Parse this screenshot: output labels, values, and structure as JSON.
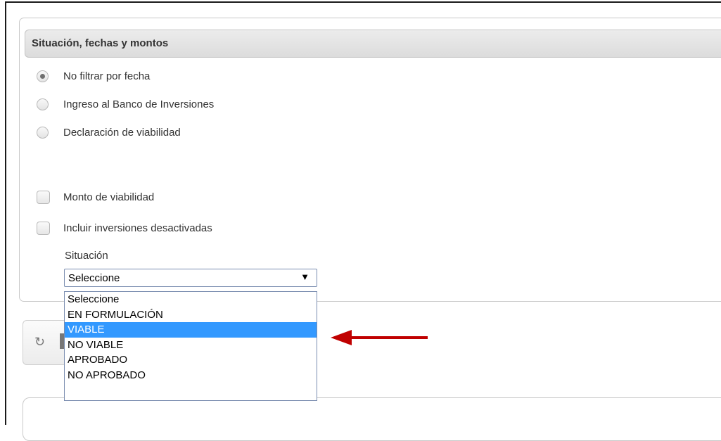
{
  "panel": {
    "title": "Situación, fechas y montos"
  },
  "date_filters": [
    {
      "label": "No filtrar por fecha",
      "checked": true
    },
    {
      "label": "Ingreso al Banco de Inversiones",
      "checked": false
    },
    {
      "label": "Declaración de viabilidad",
      "checked": false
    }
  ],
  "checkboxes": [
    {
      "label": "Monto de viabilidad",
      "checked": false
    },
    {
      "label": "Incluir inversiones desactivadas",
      "checked": false
    }
  ],
  "situacion": {
    "label": "Situación",
    "selected_value": "Seleccione",
    "options": [
      "Seleccione",
      "EN FORMULACIÓN",
      "VIABLE",
      "NO VIABLE",
      "APROBADO",
      "NO APROBADO"
    ],
    "highlighted_option": "VIABLE"
  },
  "colors": {
    "highlight": "#3399ff",
    "annotation_arrow": "#c00000"
  },
  "icons": {
    "refresh_button_icon": "refresh-icon",
    "select_arrow": "dropdown-arrow-icon"
  }
}
